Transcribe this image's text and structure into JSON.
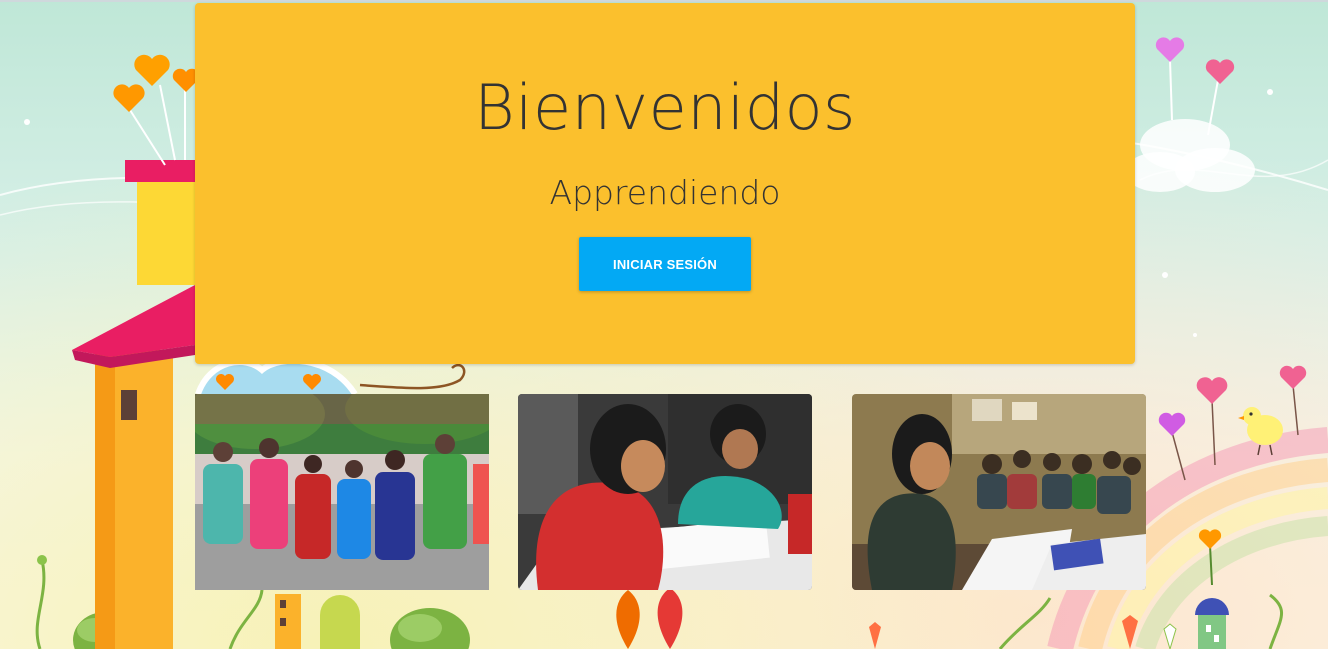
{
  "hero": {
    "title": "Bienvenidos",
    "subtitle": "Apprendiendo",
    "login_button_label": "INICIAR SESIÓN"
  },
  "colors": {
    "hero_background": "#fbc02d",
    "button_background": "#03a9f4",
    "button_text": "#ffffff",
    "heading_text": "#333333"
  },
  "photos": [
    {
      "description": "children-parade-photo"
    },
    {
      "description": "children-writing-photo"
    },
    {
      "description": "classroom-children-photo"
    }
  ]
}
